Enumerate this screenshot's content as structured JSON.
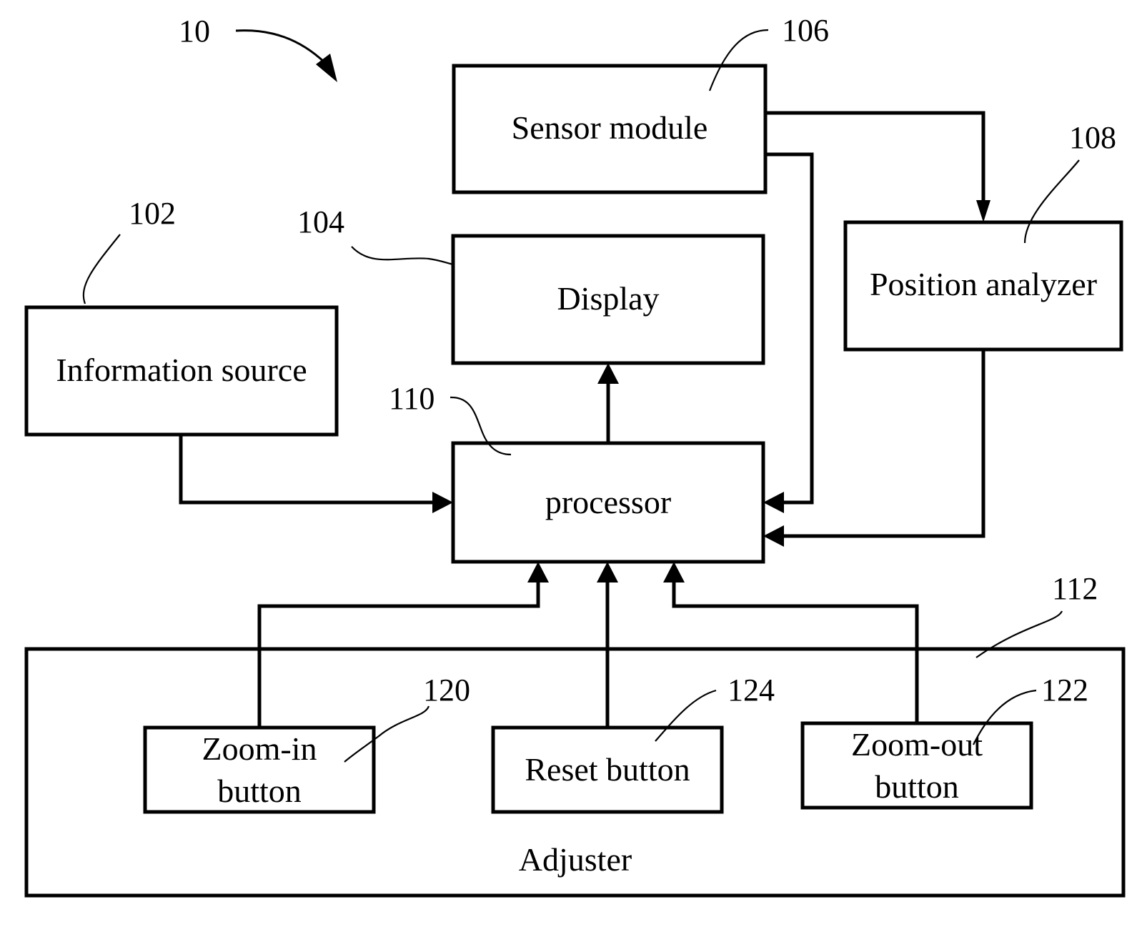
{
  "figure": {
    "ref_overall": "10",
    "blocks": {
      "sensor_module": {
        "label": "Sensor module",
        "ref": "106"
      },
      "position_analyzer": {
        "label": "Position analyzer",
        "ref": "108"
      },
      "information_source": {
        "label": "Information source",
        "ref": "102"
      },
      "display": {
        "label": "Display",
        "ref": "104"
      },
      "processor": {
        "label": "processor",
        "ref": "110"
      },
      "adjuster": {
        "label": "Adjuster",
        "ref": "112"
      },
      "zoom_in_button": {
        "label_line1": "Zoom-in",
        "label_line2": "button",
        "ref": "120"
      },
      "reset_button": {
        "label": "Reset button",
        "ref": "124"
      },
      "zoom_out_button": {
        "label_line1": "Zoom-out",
        "label_line2": "button",
        "ref": "122"
      }
    },
    "connections": [
      {
        "from": "sensor_module",
        "to": "position_analyzer"
      },
      {
        "from": "sensor_module",
        "to": "processor"
      },
      {
        "from": "position_analyzer",
        "to": "processor"
      },
      {
        "from": "information_source",
        "to": "processor"
      },
      {
        "from": "processor",
        "to": "display"
      },
      {
        "from": "zoom_in_button",
        "to": "processor"
      },
      {
        "from": "reset_button",
        "to": "processor"
      },
      {
        "from": "zoom_out_button",
        "to": "processor"
      }
    ]
  }
}
